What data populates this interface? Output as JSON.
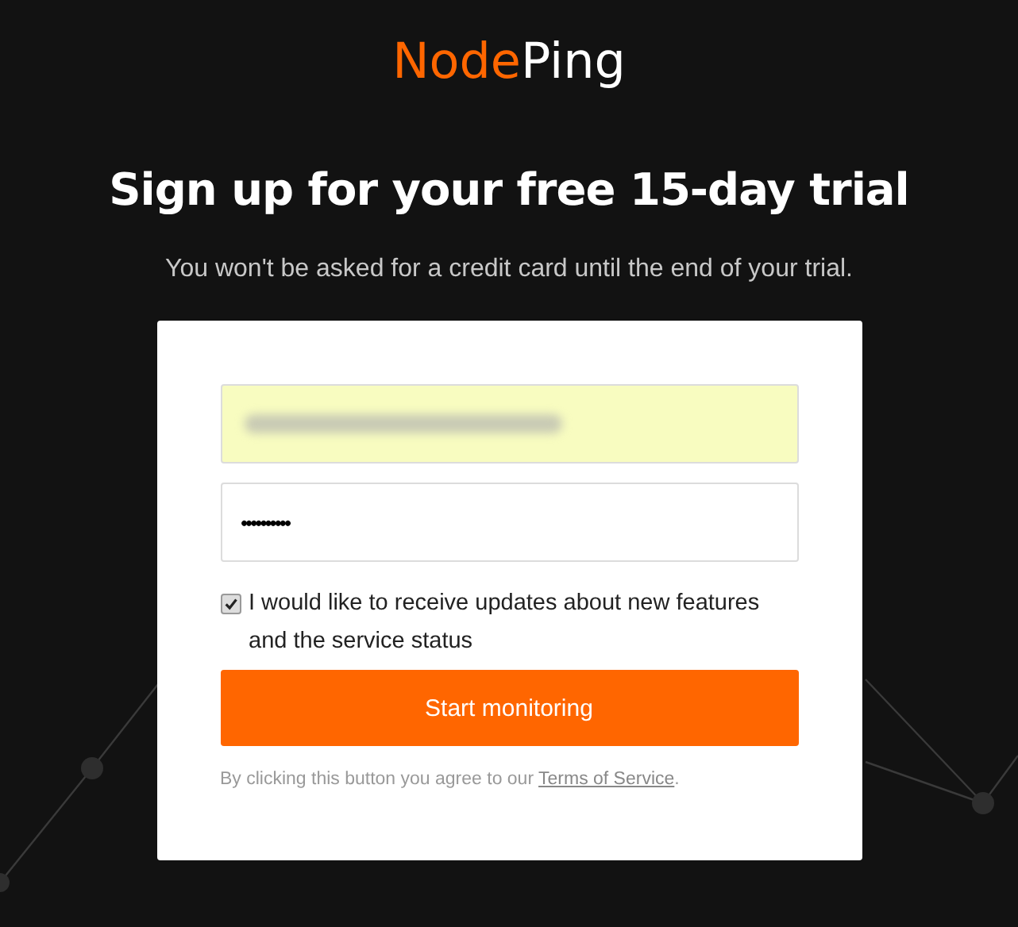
{
  "logo": {
    "part_1": "Node",
    "part_2": "Ping"
  },
  "heading": "Sign up for your free 15-day trial",
  "subheading": "You won't be asked for a credit card until the end of your trial.",
  "form": {
    "email": {
      "blurred": true,
      "autofilled": true
    },
    "password": {
      "value": "••••••••••"
    },
    "updates": {
      "checked": true,
      "label": "I would like to receive updates about new features and the service status"
    },
    "submit": "Start monitoring",
    "legal": {
      "text": "By clicking this button you agree to our ",
      "link": "Terms of Service",
      "end": "."
    }
  }
}
